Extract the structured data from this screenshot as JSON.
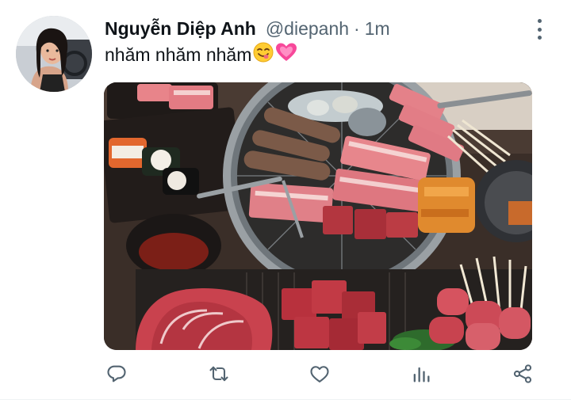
{
  "tweet": {
    "author_name": "Nguyễn Diệp Anh",
    "author_handle": "@diepanh",
    "separator": "·",
    "timestamp": "1m",
    "text": "nhăm nhăm nhăm",
    "emojis": [
      "face-savoring-food",
      "growing-heart"
    ],
    "image": "photo of korean-bbq grill with raw meats, sushi and dipping sauce"
  },
  "actions": [
    {
      "icon": "reply-icon"
    },
    {
      "icon": "retweet-icon"
    },
    {
      "icon": "like-icon"
    },
    {
      "icon": "analytics-icon"
    },
    {
      "icon": "share-icon"
    }
  ],
  "colors": {
    "text_primary": "#0f1419",
    "text_secondary": "#536471",
    "icon": "#536471",
    "divider": "#eff3f4"
  }
}
